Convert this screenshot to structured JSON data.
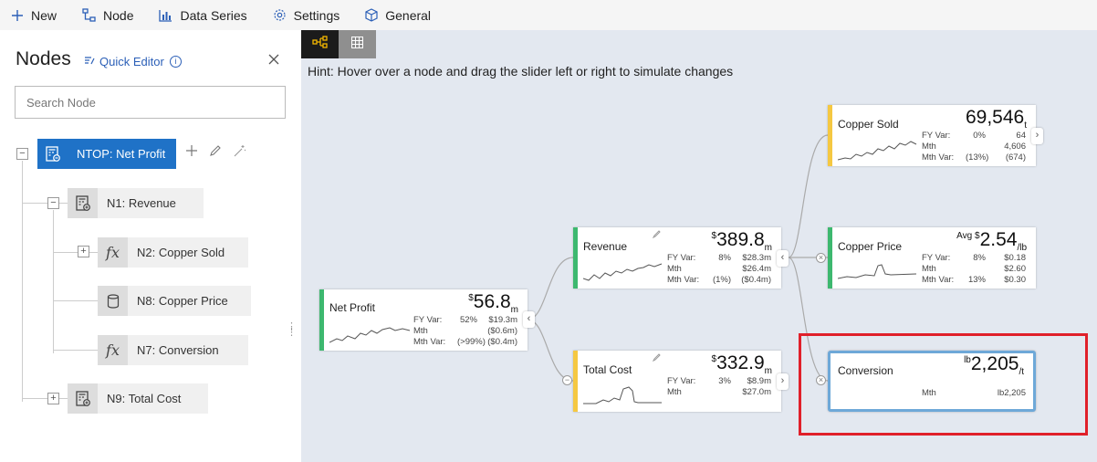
{
  "toolbar": {
    "items": [
      {
        "label": "New",
        "icon": "plus-icon"
      },
      {
        "label": "Node",
        "icon": "node-tree-icon"
      },
      {
        "label": "Data Series",
        "icon": "bar-chart-icon"
      },
      {
        "label": "Settings",
        "icon": "gear-icon"
      },
      {
        "label": "General",
        "icon": "cube-icon"
      }
    ]
  },
  "sidebar": {
    "title": "Nodes",
    "quick_editor": "Quick Editor",
    "search_placeholder": "Search Node",
    "tree": [
      {
        "label": "NTOP: Net Profit",
        "icon": "calculator-icon",
        "toggle": "−",
        "selected": true
      },
      {
        "label": "N1: Revenue",
        "icon": "calculator-icon",
        "toggle": "−"
      },
      {
        "label": "N2: Copper Sold",
        "icon": "function-icon",
        "toggle": "+"
      },
      {
        "label": "N8: Copper Price",
        "icon": "database-icon",
        "toggle": ""
      },
      {
        "label": "N7: Conversion",
        "icon": "function-icon",
        "toggle": ""
      },
      {
        "label": "N9: Total Cost",
        "icon": "calculator-icon",
        "toggle": "+"
      }
    ]
  },
  "canvas": {
    "hint": "Hint: Hover over a node and drag the slider left or right to simulate changes",
    "cards": {
      "net_profit": {
        "name": "Net Profit",
        "prefix": "$",
        "value": "56.8",
        "suffix": "m",
        "rows": [
          {
            "label": "FY Var:",
            "pct": "52%",
            "amt": "$19.3m"
          },
          {
            "label": "Mth",
            "pct": "",
            "amt": "($0.6m)"
          },
          {
            "label": "Mth Var:",
            "pct": "(>99%)",
            "amt": "($0.4m)"
          }
        ]
      },
      "revenue": {
        "name": "Revenue",
        "prefix": "$",
        "value": "389.8",
        "suffix": "m",
        "rows": [
          {
            "label": "FY Var:",
            "pct": "8%",
            "amt": "$28.3m"
          },
          {
            "label": "Mth",
            "pct": "",
            "amt": "$26.4m"
          },
          {
            "label": "Mth Var:",
            "pct": "(1%)",
            "amt": "($0.4m)"
          }
        ]
      },
      "total_cost": {
        "name": "Total Cost",
        "prefix": "$",
        "value": "332.9",
        "suffix": "m",
        "rows": [
          {
            "label": "FY Var:",
            "pct": "3%",
            "amt": "$8.9m"
          },
          {
            "label": "Mth",
            "pct": "",
            "amt": "$27.0m"
          }
        ]
      },
      "copper_sold": {
        "name": "Copper Sold",
        "prefix": "",
        "value": "69,546",
        "suffix": "t",
        "rows": [
          {
            "label": "FY Var:",
            "pct": "0%",
            "amt": "64"
          },
          {
            "label": "Mth",
            "pct": "",
            "amt": "4,606"
          },
          {
            "label": "Mth Var:",
            "pct": "(13%)",
            "amt": "(674)"
          }
        ]
      },
      "copper_price": {
        "name": "Copper Price",
        "prefix": "Avg $",
        "value": "2.54",
        "suffix": "/lb",
        "rows": [
          {
            "label": "FY Var:",
            "pct": "8%",
            "amt": "$0.18"
          },
          {
            "label": "Mth",
            "pct": "",
            "amt": "$2.60"
          },
          {
            "label": "Mth Var:",
            "pct": "13%",
            "amt": "$0.30"
          }
        ]
      },
      "conversion": {
        "name": "Conversion",
        "prefix": "lb",
        "value": "2,205",
        "suffix": "/t",
        "rows": [
          {
            "label": "Mth",
            "pct": "",
            "amt": "lb2,205"
          }
        ]
      }
    }
  }
}
